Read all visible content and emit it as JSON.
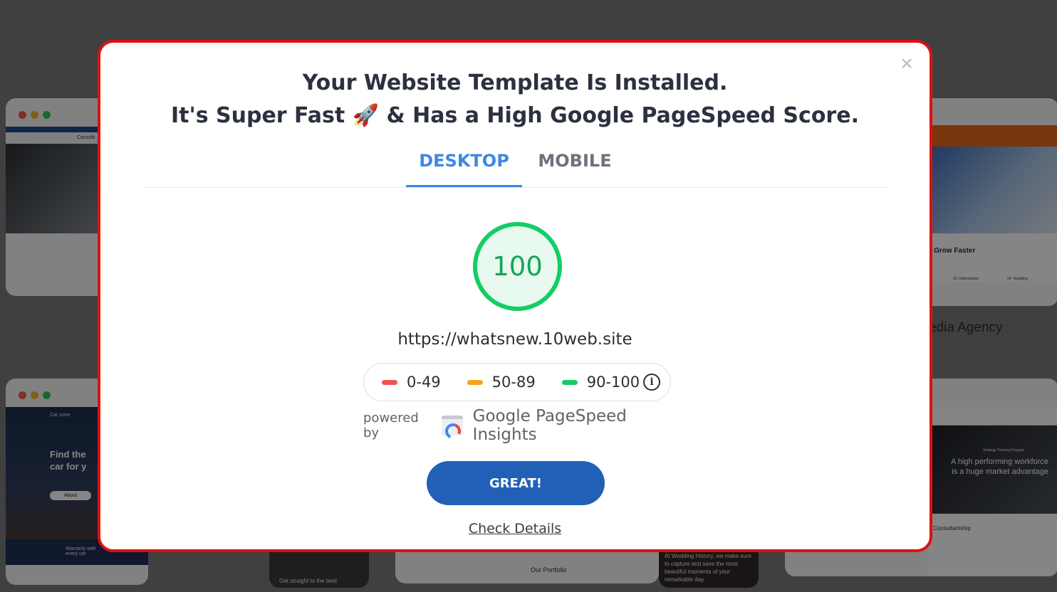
{
  "modal": {
    "title_line1": "Your Website Template Is Installed.",
    "title_line2_a": "It's Super Fast",
    "title_rocket": "🚀",
    "title_line2_b": "& Has a High Google PageSpeed Score.",
    "close_glyph": "×",
    "tabs": [
      {
        "label": "DESKTOP",
        "active": true
      },
      {
        "label": "MOBILE",
        "active": false
      }
    ],
    "score": "100",
    "url": "https://whatsnew.10web.site",
    "legend": [
      {
        "range": "0-49",
        "color": "#f05350"
      },
      {
        "range": "50-89",
        "color": "#f7a418"
      },
      {
        "range": "90-100",
        "color": "#12ce64"
      }
    ],
    "info_glyph": "i",
    "powered_by": "powered by",
    "provider": "Google PageSpeed Insights",
    "primary_button": "GREAT!",
    "secondary_link": "Check Details"
  },
  "background": {
    "labels": [
      "edia Agency",
      "Our Portfolio"
    ],
    "snippets": {
      "consult": "Consulti",
      "find_the": "Find the",
      "car_for": "car for y",
      "about": "About",
      "car_zone": "Car zone",
      "warranty": "Warranty with every car",
      "grow": "Grow Faster",
      "optimization": "03. Optimization",
      "targeting": "04. Targeting",
      "high_perf": "A high performing workforce is a huge market advantage",
      "strategy": "Strategy Training Program",
      "consultantship": "Consultantship",
      "straight": "Get straight to the best",
      "wedding": "At Wedding History, we make sure to capture and save the most beautiful moments of your remarkable day."
    }
  },
  "colors": {
    "accent_blue": "#3f87e6",
    "button_blue": "#2260b7",
    "score_green": "#12ce64",
    "modal_border": "#e10f0f"
  }
}
